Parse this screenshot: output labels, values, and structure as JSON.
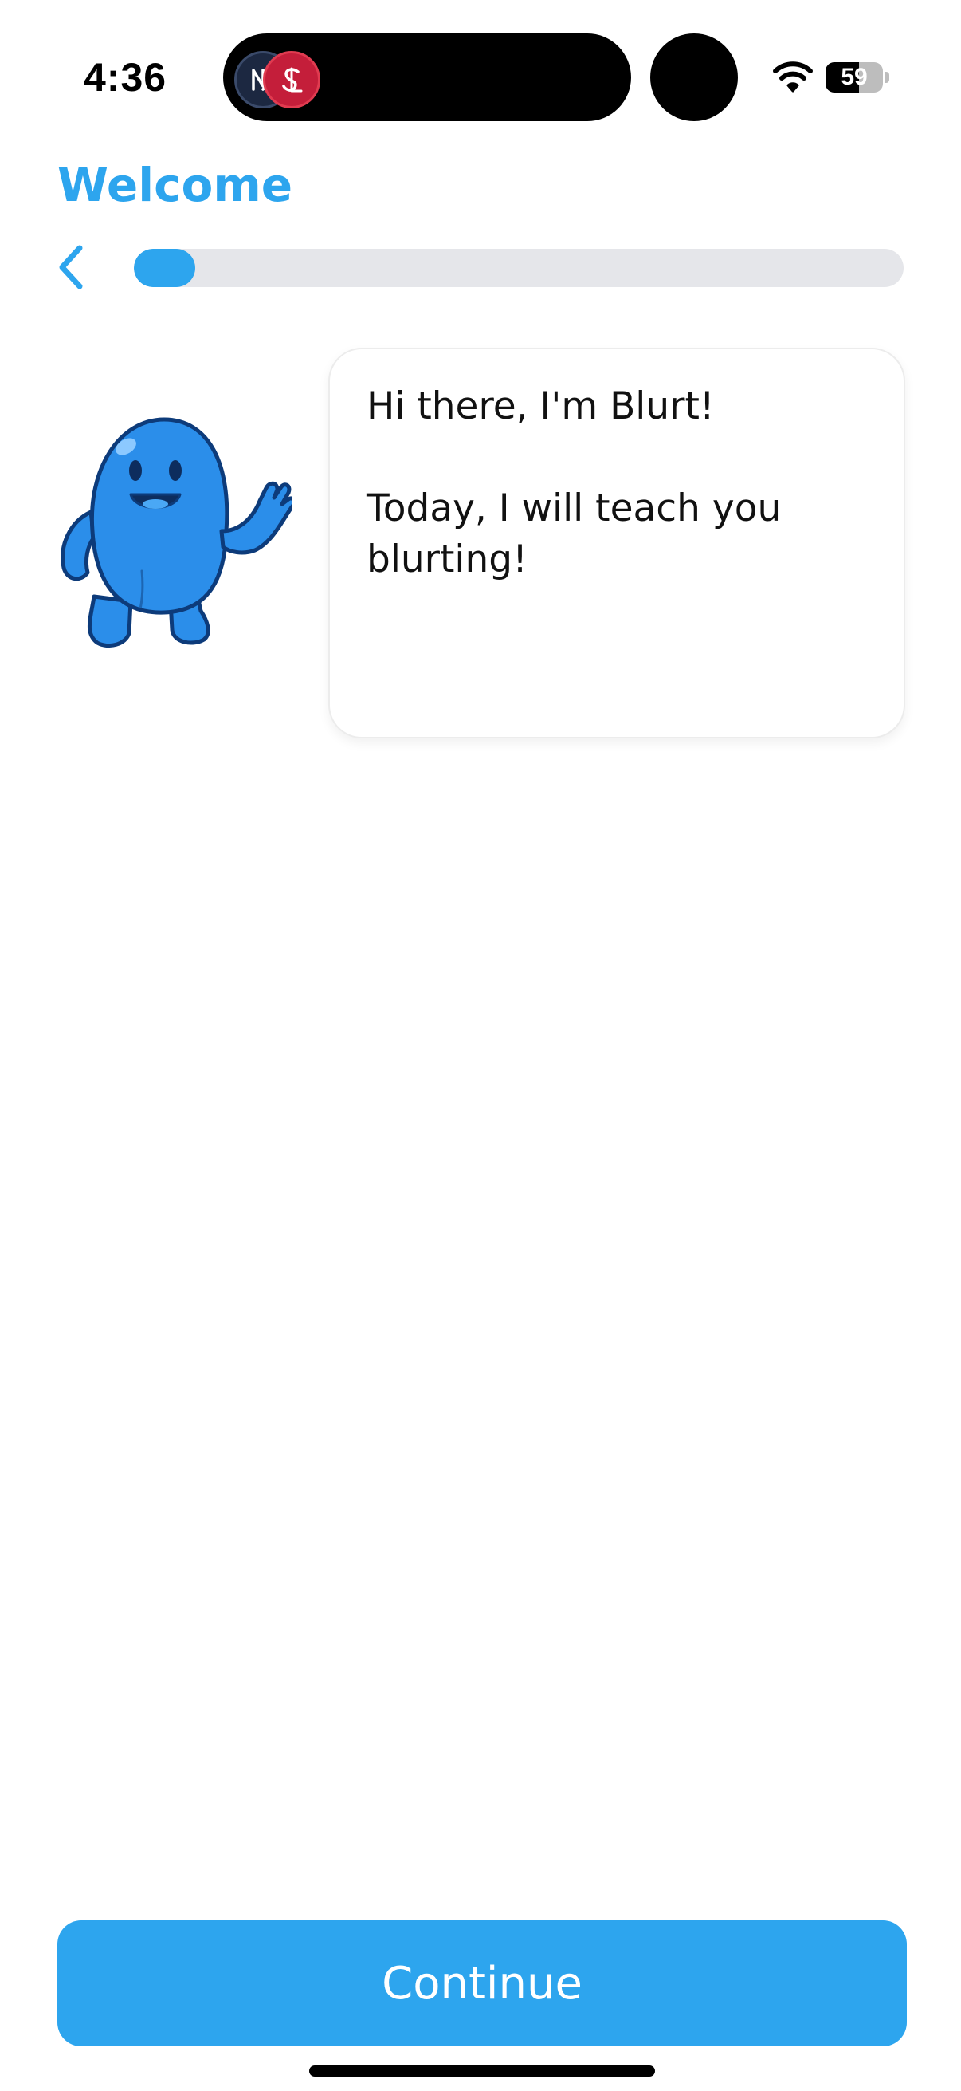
{
  "status_bar": {
    "time": "4:36",
    "battery": "59",
    "battery_level": 0.59,
    "live_activity_logos": [
      "NY",
      "STL"
    ]
  },
  "header": {
    "title": "Welcome",
    "progress": 0.08
  },
  "bubble": {
    "greeting": "Hi there, I'm Blurt!",
    "message_line1": "Today, I will teach you",
    "message_line2": "blurting!"
  },
  "footer": {
    "continue_label": "Continue"
  },
  "colors": {
    "accent": "#2da5ee",
    "track": "#e5e6ea",
    "mascot_body": "#2b8eea",
    "mascot_outline": "#0d3b7a"
  },
  "icons": {
    "back": "chevron-left-icon",
    "wifi": "wifi-icon",
    "battery": "battery-icon"
  }
}
